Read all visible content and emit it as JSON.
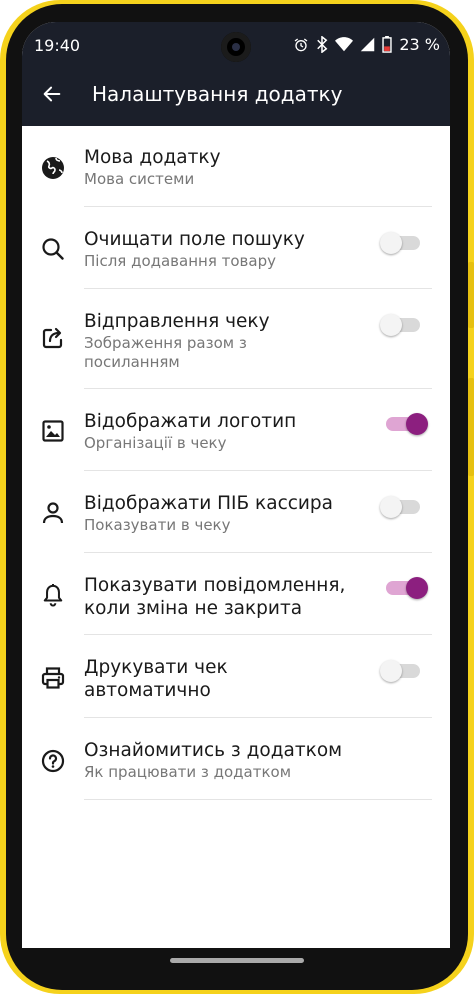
{
  "status_bar": {
    "time": "19:40",
    "battery_percent": "23 %",
    "icons": [
      "alarm-icon",
      "bluetooth-icon",
      "wifi-icon",
      "signal-icon",
      "battery-low-icon"
    ]
  },
  "header": {
    "title": "Налаштування додатку",
    "back_icon": "arrow-left-icon",
    "background": "#1b1f2a"
  },
  "settings": [
    {
      "id": "language",
      "icon": "globe-icon",
      "title": "Мова додатку",
      "subtitle": "Мова системи",
      "toggle": null
    },
    {
      "id": "clear-search",
      "icon": "search-icon",
      "title": "Очищати поле пошуку",
      "subtitle": "Після додавання товару",
      "toggle": "off"
    },
    {
      "id": "send-receipt",
      "icon": "share-icon",
      "title": "Відправлення чеку",
      "subtitle": "Зображення разом з посиланням",
      "toggle": "off"
    },
    {
      "id": "show-logo",
      "icon": "image-icon",
      "title": "Відображати логотип",
      "subtitle": "Організації в чеку",
      "toggle": "on"
    },
    {
      "id": "show-cashier",
      "icon": "person-icon",
      "title": "Відображати ПІБ кассира",
      "subtitle": "Показувати в чеку",
      "toggle": "off"
    },
    {
      "id": "notifications",
      "icon": "bell-icon",
      "title": "Показувати повідомлення, коли зміна не закрита",
      "subtitle": "",
      "toggle": "on"
    },
    {
      "id": "auto-print",
      "icon": "printer-icon",
      "title": "Друкувати чек автоматично",
      "subtitle": "",
      "toggle": "off"
    },
    {
      "id": "about",
      "icon": "help-circle-icon",
      "title": "Ознайомитись з додатком",
      "subtitle": "Як працювати з додатком",
      "toggle": null
    }
  ],
  "colors": {
    "accent": "#8c1f7f",
    "accent_track": "#dfa5d3",
    "frame": "#f5d21c"
  }
}
